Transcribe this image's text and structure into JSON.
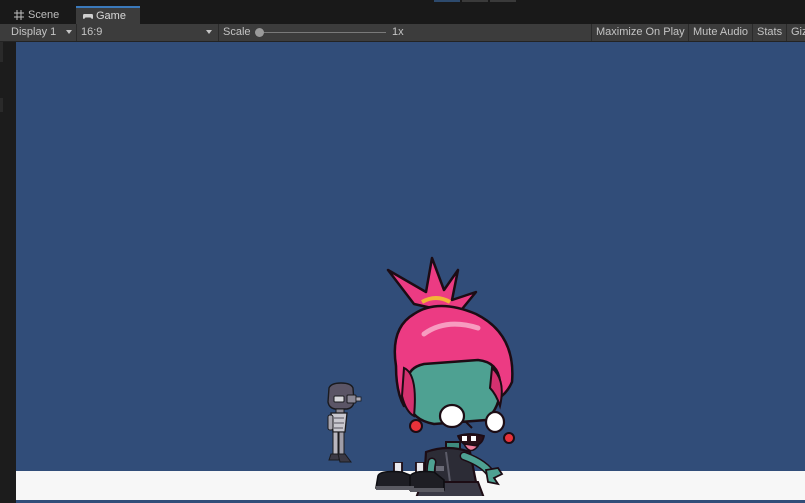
{
  "tabs": [
    {
      "label": "Scene",
      "icon": "grid-icon"
    },
    {
      "label": "Game",
      "icon": "gamepad-icon"
    }
  ],
  "toolbar": {
    "display": "Display 1",
    "aspect": "16:9",
    "scale_label": "Scale",
    "scale_value": "1x",
    "maximize_on_play": "Maximize On Play",
    "mute_audio": "Mute Audio",
    "stats": "Stats",
    "gizmos": "Giz"
  },
  "colors": {
    "game_background": "#314d79",
    "ground": "#f7f7f7",
    "active_tab_accent": "#3a79bb"
  }
}
